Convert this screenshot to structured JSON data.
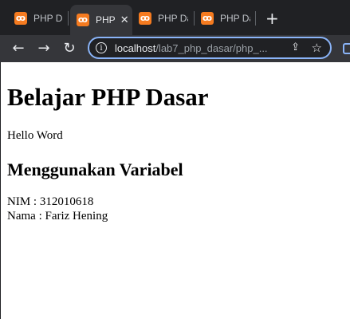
{
  "tabs": [
    {
      "title": "PHP Da",
      "active": false
    },
    {
      "title": "PHP",
      "active": true
    },
    {
      "title": "PHP Da",
      "active": false
    },
    {
      "title": "PHP Da",
      "active": false
    }
  ],
  "tab_close_symbol": "✕",
  "new_tab_symbol": "+",
  "favicon_glyph": "ꝏ",
  "nav": {
    "back_icon": "←",
    "forward_icon": "→",
    "reload_icon": "↻"
  },
  "address": {
    "host": "localhost",
    "path": "/lab7_php_dasar/php_...",
    "info_icon": "i"
  },
  "address_actions": {
    "share_icon": "⇪",
    "bookmark_icon": "☆"
  },
  "page": {
    "h1": "Belajar PHP Dasar",
    "hello": "Hello Word",
    "h2": "Menggunakan Variabel",
    "nim_line": "NIM : 312010618",
    "nama_line": "Nama : Fariz Hening"
  },
  "colors": {
    "tabbar": "#202124",
    "toolbar": "#35363a",
    "focus_ring": "#8ab4f8",
    "favicon": "#f57b20"
  }
}
